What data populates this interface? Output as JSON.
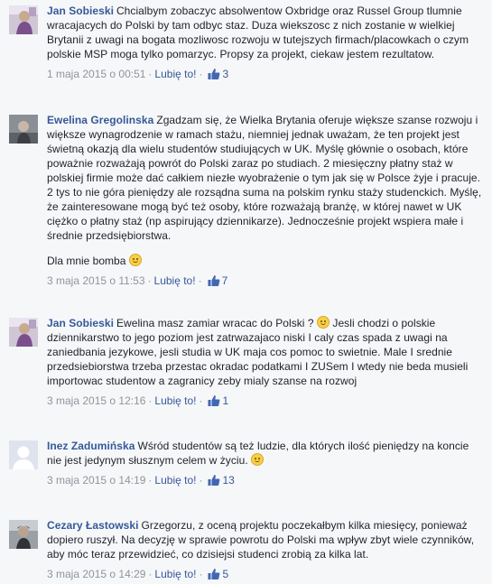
{
  "comments": [
    {
      "author": "Jan Sobieski",
      "text": "Chcialbym zobaczyc absolwentow Oxbridge oraz Russel Group tlumnie wracajacych do Polski by tam odbyc staz. Duza wiekszosc z nich zostanie w wielkiej Brytanii z uwagi na bogata mozliwosc rozwoju w tutejszych firmach/placowkach o czym polskie MSP moga tylko pomarzyc. Propsy za projekt, ciekaw jestem rezultatow.",
      "date": "1 maja 2015 o 00:51",
      "like_label": "Lubię to!",
      "likes": "3",
      "avatar": "photo-avatar"
    },
    {
      "author": "Ewelina Gregolinska",
      "text": "Zgadzam się, że Wielka Brytania oferuje większe szanse rozwoju i większe wynagrodzenie w ramach stażu, niemniej jednak uważam, że ten projekt jest świetną okazją dla wielu studentów studiujących w UK. Myślę głównie o osobach, które poważnie rozważają powrót do Polski zaraz po studiach. 2 miesięczny płatny staż w polskiej firmie może dać całkiem niezłe wyobrażenie o tym jak się w Polsce żyje i pracuje. 2 tys to nie góra pieniędzy ale rozsądna suma na polskim rynku staży studenckich. Myślę, że zainteresowane mogą być też osoby, które rozważają branżę, w której nawet w UK ciężko o płatny staż (np aspirujący dziennikarze). Jednocześnie projekt wspiera małe i średnie przedsiębiorstwa.",
      "extra": "Dla mnie bomba",
      "date": "3 maja 2015 o 11:53",
      "like_label": "Lubię to!",
      "likes": "7",
      "avatar": "photo-avatar"
    },
    {
      "author": "Jan Sobieski",
      "text_a": "Ewelina masz zamiar wracac do Polski ?",
      "text_b": "Jesli chodzi o polskie dziennikarstwo to jego poziom jest zatrwazajaco niski I caly czas spada z uwagi na zaniedbania jezykowe, jesli studia w UK maja cos pomoc to swietnie. Male I srednie przedsiebiorstwa trzeba przestac okradac podatkami I ZUSem I wtedy nie beda musieli importowac studentow a zagranicy zeby mialy szanse na rozwoj",
      "date": "3 maja 2015 o 12:16",
      "like_label": "Lubię to!",
      "likes": "1",
      "avatar": "photo-avatar"
    },
    {
      "author": "Inez Zadumińska",
      "text": "Wśród studentów są też ludzie, dla których ilość pieniędzy na koncie nie jest jedynym słusznym celem w życiu.",
      "date": "3 maja 2015 o 14:19",
      "like_label": "Lubię to!",
      "likes": "13",
      "avatar": "default-avatar"
    },
    {
      "author": "Cezary Łastowski",
      "text": "Grzegorzu, z oceną projektu poczekałbym kilka miesięcy, ponieważ dopiero ruszył. Na decyzję w sprawie powrotu do Polski ma wpływ zbyt wiele czynników, aby móc teraz przewidzieć, co dzisiejsi studenci zrobią za kilka lat.",
      "date": "3 maja 2015 o 14:29",
      "like_label": "Lubię to!",
      "likes": "5",
      "avatar": "photo-avatar"
    }
  ],
  "separator": "·",
  "colors": {
    "link": "#365899",
    "meta": "#90949c",
    "background": "#f6f7f9"
  }
}
